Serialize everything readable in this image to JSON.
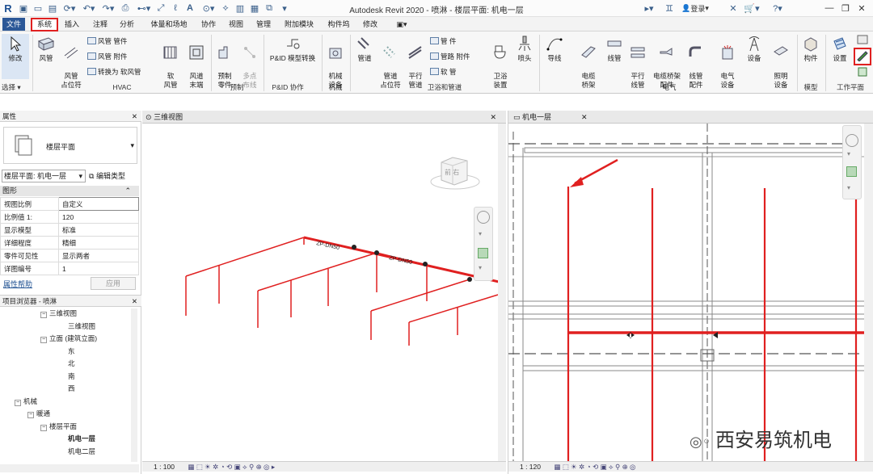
{
  "window": {
    "title": "Autodesk Revit 2020 - 喷淋 - 楼层平面: 机电一层",
    "sign_in": "登录"
  },
  "menu": {
    "tabs": [
      "文件",
      "系统",
      "插入",
      "注释",
      "分析",
      "体量和场地",
      "协作",
      "视图",
      "管理",
      "附加模块",
      "构件坞",
      "修改"
    ],
    "active_tab": "系统",
    "extra": "▣▾"
  },
  "ribbon": {
    "select": {
      "label": "修改",
      "group": "选择 ▾"
    },
    "hvac": {
      "duct": "风管",
      "duct_placeholder": "风管\n占位符",
      "duct_fitting": "风管 管件",
      "duct_accessory": "风管 附件",
      "convert_flex": "转换为 软风管",
      "flex_duct": "软\n风管",
      "air_terminal": "风道\n末端",
      "group": "HVAC"
    },
    "prefab": {
      "parts": "预制\n零件",
      "multipoint": "多点\n布线",
      "group": "预制"
    },
    "pid": {
      "modeling": "P&ID 模型转换",
      "group": "P&ID 协作"
    },
    "mech": {
      "equipment": "机械\n设备",
      "group": "机械"
    },
    "plumbing": {
      "pipe": "管道",
      "pipe_placeholder": "管道\n占位符",
      "parallel_pipe": "平行\n管道",
      "pipe_fitting": "管 件",
      "pipe_accessory": "管路 附件",
      "flex_pipe": "软 管",
      "fixture": "卫浴\n装置",
      "sprinkler": "喷头",
      "group": "卫浴和管道"
    },
    "electrical": {
      "wire": "导线",
      "cable_tray": "电缆\n桥架",
      "conduit": "线管",
      "parallel_conduit": "平行\n线管",
      "tray_fitting": "电缆桥架\n配件",
      "conduit_fitting": "线管\n配件",
      "elec_equipment": "电气\n设备",
      "devices": "设备",
      "lighting": "照明\n设备",
      "group": "电气"
    },
    "model": {
      "component": "构件",
      "group": "模型"
    },
    "workplane": {
      "set": "设置",
      "group": "工作平面"
    }
  },
  "properties": {
    "title": "属性",
    "type_name": "楼层平面",
    "selector": "楼层平面: 机电一层",
    "edit_type": "编辑类型",
    "section": "图形",
    "rows": [
      {
        "key": "视图比例",
        "val": "自定义"
      },
      {
        "key": "比例值 1:",
        "val": "120"
      },
      {
        "key": "显示模型",
        "val": "标准"
      },
      {
        "key": "详细程度",
        "val": "精细"
      },
      {
        "key": "零件可见性",
        "val": "显示两者"
      },
      {
        "key": "详图编号",
        "val": "1"
      }
    ],
    "help": "属性帮助",
    "apply": "应用"
  },
  "browser": {
    "title": "项目浏览器 - 喷淋",
    "items": [
      {
        "label": "三维视图",
        "toggle": "−",
        "indent": 50,
        "bold": false
      },
      {
        "label": "三维视图",
        "toggle": "",
        "indent": 84,
        "bold": false
      },
      {
        "label": "立面 (建筑立面)",
        "toggle": "−",
        "indent": 50,
        "bold": false
      },
      {
        "label": "东",
        "toggle": "",
        "indent": 84,
        "bold": false
      },
      {
        "label": "北",
        "toggle": "",
        "indent": 84,
        "bold": false
      },
      {
        "label": "南",
        "toggle": "",
        "indent": 84,
        "bold": false
      },
      {
        "label": "西",
        "toggle": "",
        "indent": 84,
        "bold": false
      },
      {
        "label": "机械",
        "toggle": "−",
        "indent": 18,
        "bold": false
      },
      {
        "label": "暖通",
        "toggle": "−",
        "indent": 34,
        "bold": false
      },
      {
        "label": "楼层平面",
        "toggle": "−",
        "indent": 50,
        "bold": false
      },
      {
        "label": "机电一层",
        "toggle": "",
        "indent": 84,
        "bold": true
      },
      {
        "label": "机电二层",
        "toggle": "",
        "indent": 84,
        "bold": false
      }
    ]
  },
  "view3d": {
    "tab": "三维视图",
    "scale": "1 : 100",
    "cube_face": "前 右",
    "pipe_label1": "ZP-DN50",
    "pipe_label2": "ZP-DN50"
  },
  "viewplan": {
    "tab": "机电一层",
    "scale": "1 : 120"
  },
  "watermark": "西安易筑机电",
  "colors": {
    "accent": "#2b5797",
    "pipe": "#e02020",
    "highlight": "#e02020"
  }
}
